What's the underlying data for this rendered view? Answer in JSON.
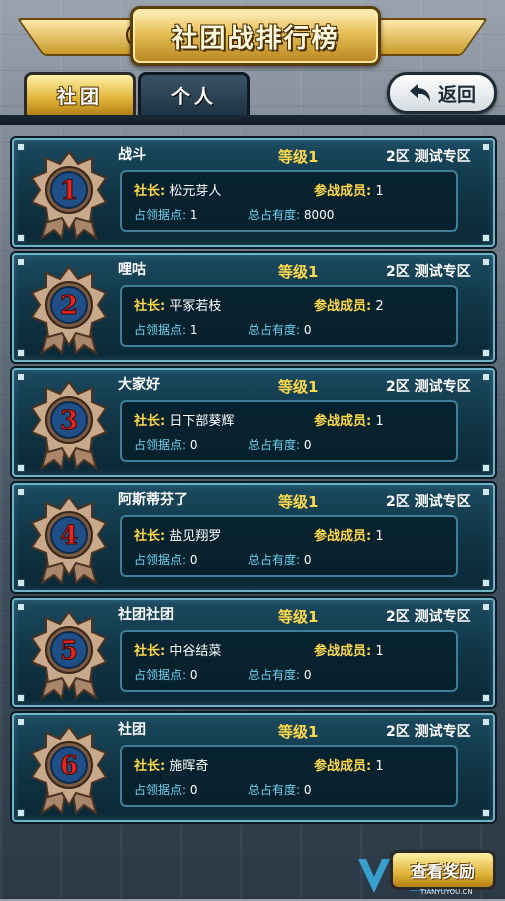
{
  "header": {
    "title": "社团战排行榜"
  },
  "tabs": [
    {
      "label": "社团",
      "active": true
    },
    {
      "label": "个人",
      "active": false
    }
  ],
  "back_button": {
    "label": "返回"
  },
  "labels": {
    "leader": "社长:",
    "members": "参战成员:",
    "points": "占领据点:",
    "total": "总占有度:"
  },
  "clans": [
    {
      "rank": "1",
      "name": "战斗",
      "level": "等级1",
      "server": "2区 测试专区",
      "leader": "松元芽人",
      "members": "1",
      "points": "1",
      "total": "8000"
    },
    {
      "rank": "2",
      "name": "哩咕",
      "level": "等级1",
      "server": "2区 测试专区",
      "leader": "平冢若枝",
      "members": "2",
      "points": "1",
      "total": "0"
    },
    {
      "rank": "3",
      "name": "大家好",
      "level": "等级1",
      "server": "2区 测试专区",
      "leader": "日下部葵辉",
      "members": "1",
      "points": "0",
      "total": "0"
    },
    {
      "rank": "4",
      "name": "阿斯蒂芬了",
      "level": "等级1",
      "server": "2区 测试专区",
      "leader": "盐见翔罗",
      "members": "1",
      "points": "0",
      "total": "0"
    },
    {
      "rank": "5",
      "name": "社团社团",
      "level": "等级1",
      "server": "2区 测试专区",
      "leader": "中谷结菜",
      "members": "1",
      "points": "0",
      "total": "0"
    },
    {
      "rank": "6",
      "name": "社团",
      "level": "等级1",
      "server": "2区 测试专区",
      "leader": "施晖奇",
      "members": "1",
      "points": "0",
      "total": "0"
    }
  ],
  "footer": {
    "reward_button": "查看奖励"
  },
  "watermark": {
    "url": "TIANYUYOU.CN"
  },
  "colors": {
    "accent": "#ffd84a",
    "card_border": "#6fb3c9",
    "sublabel": "#6fd1f0",
    "rank_number": "#e8241c"
  }
}
